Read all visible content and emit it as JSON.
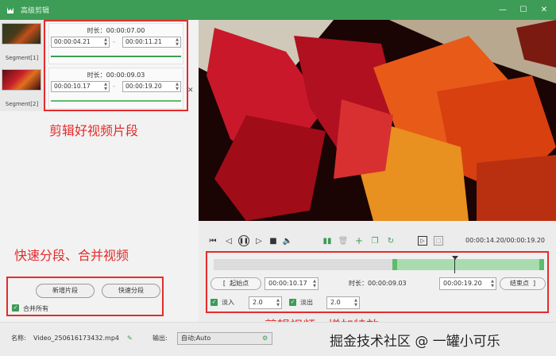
{
  "window": {
    "title": "高级剪辑"
  },
  "segments": {
    "thumbs": [
      {
        "label": "Segment[1]"
      },
      {
        "label": "Segment[2]"
      }
    ],
    "items": [
      {
        "duration": "时长：00:00:07.00",
        "start": "00:00:04.21",
        "end": "00:00:11.21"
      },
      {
        "duration": "时长：00:00:09.03",
        "start": "00:00:10.17",
        "end": "00:00:19.20"
      }
    ],
    "dash": "-"
  },
  "annotations": {
    "segments_note": "剪辑好视频片段",
    "split_note": "快速分段、合并视频",
    "edit_note": "剪辑视频、增加特效"
  },
  "left_buttons": {
    "add_segment": "新增片段",
    "quick_split": "快速分段",
    "merge_all": "合并所有"
  },
  "player": {
    "timecode": "00:00:14.20/00:00:19.20"
  },
  "trim": {
    "start_btn": "起始点",
    "start_value": "00:00:10.17",
    "duration_label": "时长：00:00:09.03",
    "end_value": "00:00:19.20",
    "end_btn": "结束点",
    "fade_in_label": "淡入",
    "fade_in_value": "2.0",
    "fade_out_label": "淡出",
    "fade_out_value": "2.0",
    "bracket_left": "[",
    "bracket_right": "]"
  },
  "bottom": {
    "name_label": "名称:",
    "name_value": "Video_250616173432.mp4",
    "output_label": "输出:",
    "output_value": "自动;Auto"
  },
  "watermark": "掘金技术社区 @ 一罐小可乐",
  "colors": {
    "accent": "#3d9c56",
    "annotation": "#e52b2b"
  }
}
